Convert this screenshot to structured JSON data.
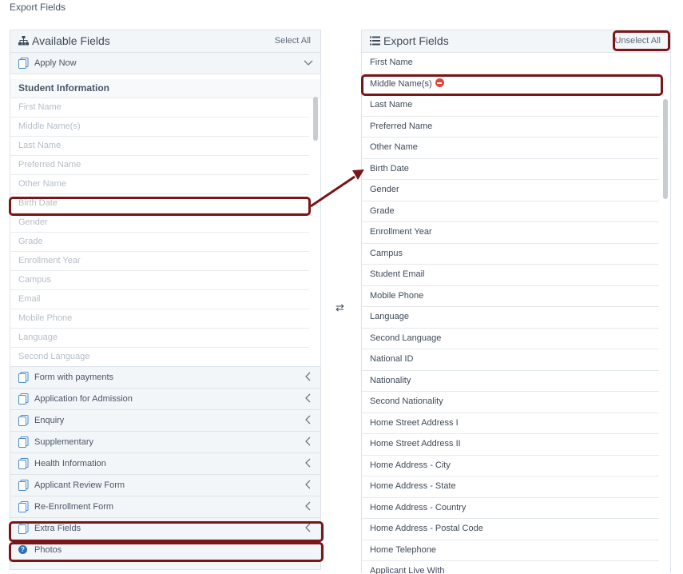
{
  "page_title": "Export Fields",
  "left_panel": {
    "title": "Available Fields",
    "action_label": "Select All",
    "top_form": "Apply Now",
    "group_title": "Student Information",
    "fields": [
      "First Name",
      "Middle Name(s)",
      "Last Name",
      "Preferred Name",
      "Other Name",
      "Birth Date",
      "Gender",
      "Grade",
      "Enrollment Year",
      "Campus",
      "Email",
      "Mobile Phone",
      "Language",
      "Second Language"
    ],
    "forms": [
      "Form with payments",
      "Application for Admission",
      "Enquiry",
      "Supplementary",
      "Health Information",
      "Applicant Review Form",
      "Re-Enrollment Form",
      "Extra Fields"
    ],
    "photos_label": "Photos"
  },
  "swap_symbol": "⇄",
  "right_panel": {
    "title": "Export Fields",
    "action_label": "Unselect All",
    "fields": [
      "First Name",
      "Middle Name(s)",
      "Last Name",
      "Preferred Name",
      "Other Name",
      "Birth Date",
      "Gender",
      "Grade",
      "Enrollment Year",
      "Campus",
      "Student Email",
      "Mobile Phone",
      "Language",
      "Second Language",
      "National ID",
      "Nationality",
      "Second Nationality",
      "Home Street Address I",
      "Home Street Address II",
      "Home Address - City",
      "Home Address - State",
      "Home Address - Country",
      "Home Address - Postal Code",
      "Home Telephone",
      "Applicant Live With"
    ]
  },
  "colors": {
    "highlight": "#7a1518",
    "remove": "#e2453a",
    "accent": "#2f6fb0"
  }
}
